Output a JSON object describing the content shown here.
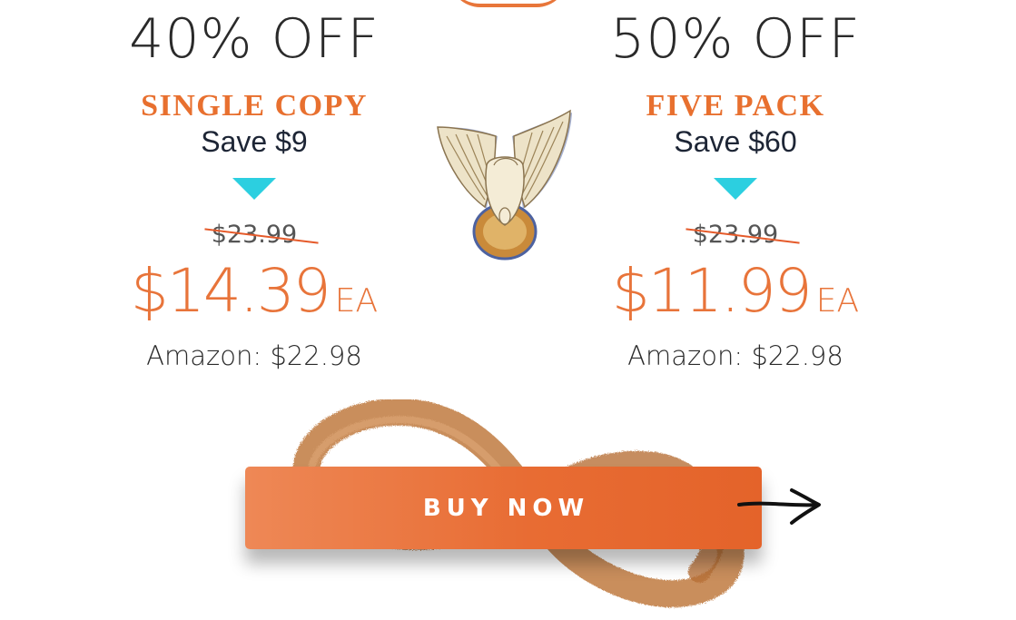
{
  "offers": [
    {
      "discount": "40% OFF",
      "title": "SINGLE COPY",
      "savings": "Save $9",
      "original_price": "$23.99",
      "price": "$14.39",
      "unit": "EA",
      "comparison": "Amazon: $22.98"
    },
    {
      "discount": "50% OFF",
      "title": "FIVE PACK",
      "savings": "Save $60",
      "original_price": "$23.99",
      "price": "$11.99",
      "unit": "EA",
      "comparison": "Amazon: $22.98"
    }
  ],
  "cta": {
    "label": "BUY NOW"
  },
  "icons": {
    "down_triangle": "down-triangle-icon",
    "emblem": "winged-emblem",
    "arrow": "arrow-right-icon"
  },
  "colors": {
    "accent_orange": "#e8702f",
    "triangle_cyan": "#2ccfe0",
    "strike_red": "#e55a2a",
    "dark_text": "#1d2535"
  }
}
